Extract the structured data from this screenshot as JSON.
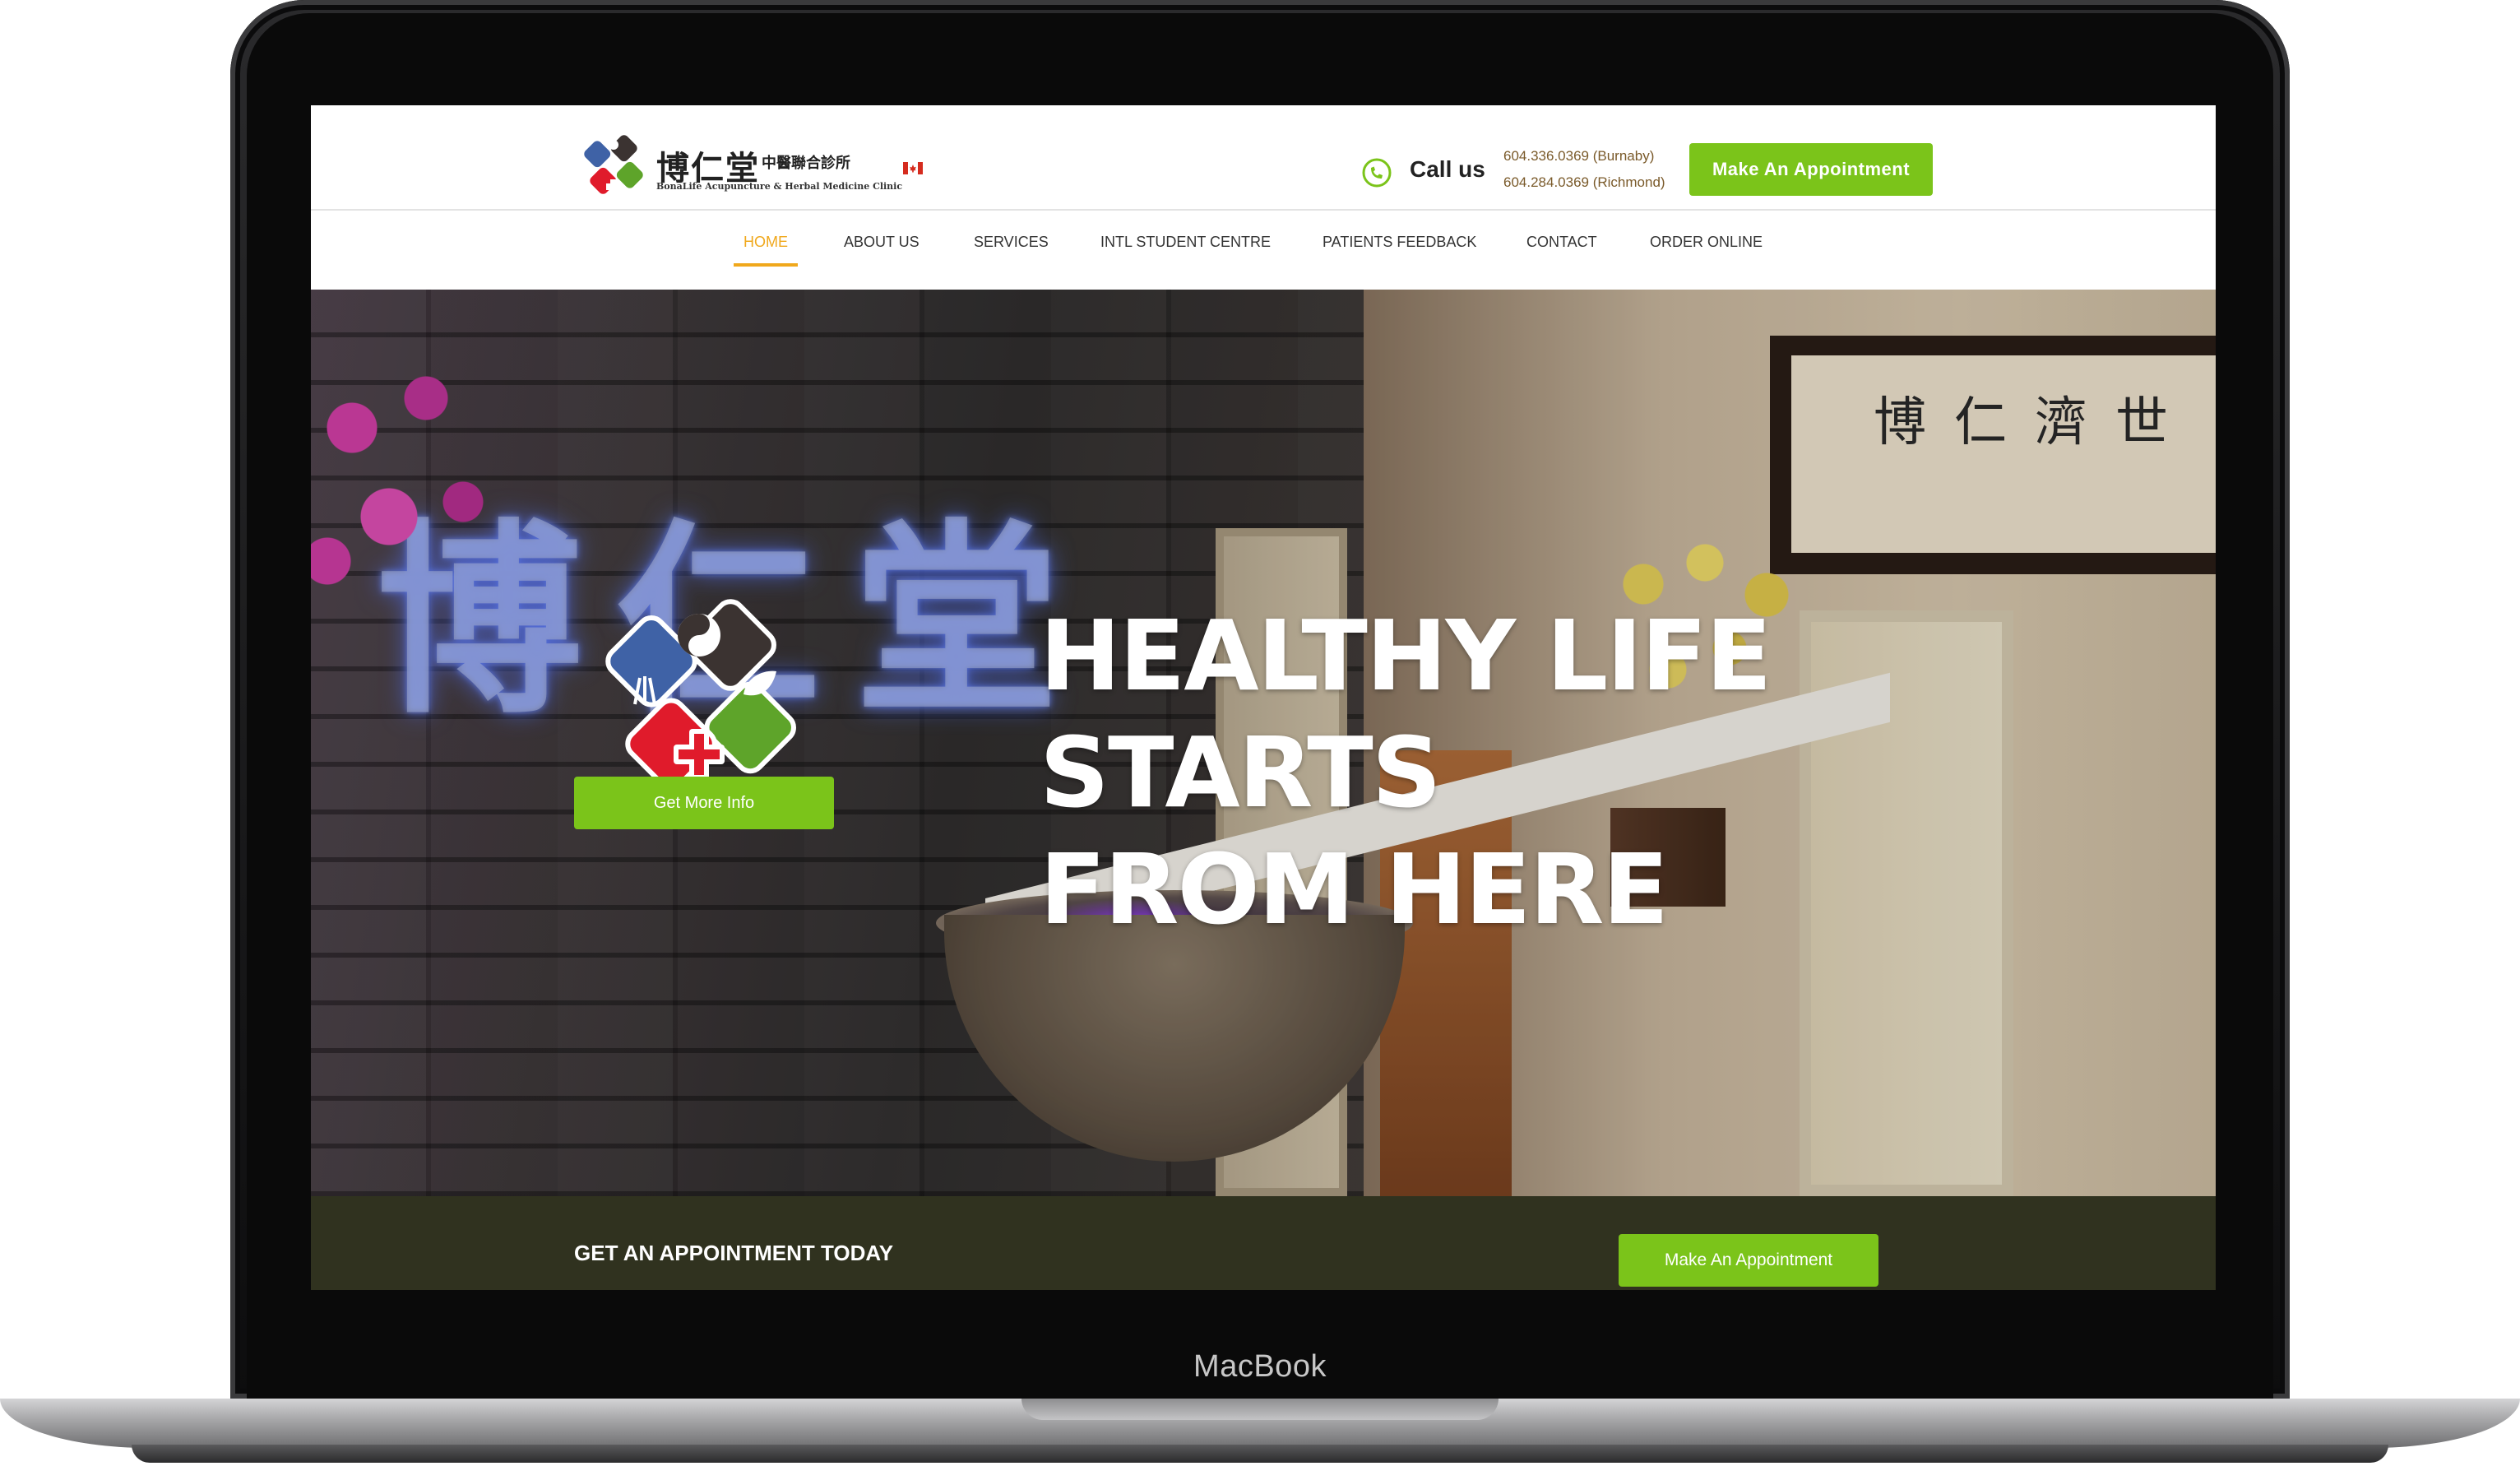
{
  "device": {
    "label": "MacBook"
  },
  "header": {
    "logo_chinese": "博仁堂",
    "logo_chinese_small": "中醫聯合診所",
    "logo_english": "BonaLife Acupuncture & Herbal Medicine Clinic",
    "call_label": "Call us",
    "phone_burnaby": "604.336.0369 (Burnaby)",
    "phone_richmond": "604.284.0369 (Richmond)",
    "appointment_button": "Make An Appointment"
  },
  "nav": {
    "items": [
      {
        "label": "HOME",
        "active": true
      },
      {
        "label": "ABOUT US"
      },
      {
        "label": "SERVICES"
      },
      {
        "label": "INTL STUDENT CENTRE"
      },
      {
        "label": "PATIENTS FEEDBACK"
      },
      {
        "label": "CONTACT"
      },
      {
        "label": "ORDER ONLINE"
      }
    ]
  },
  "hero": {
    "title_lines": [
      "HEALTHY LIFE",
      "STARTS",
      "FROM HERE"
    ],
    "cta_button": "Get More Info",
    "wall_sign": "博仁堂",
    "calligraphy": "博仁濟世"
  },
  "appointment_bar": {
    "text": "GET AN APPOINTMENT TODAY",
    "button": "Make An Appointment"
  },
  "colors": {
    "accent_green": "#7bc41a",
    "nav_active": "#f0a81c",
    "bar_background": "#30321f",
    "logo_blue": "#3f62a6",
    "logo_green": "#5ea42a",
    "logo_red": "#e01b2b",
    "logo_dark": "#3b3331"
  },
  "icons": {
    "logo": "bonalife-logo-icon",
    "flag": "canada-flag-icon",
    "phone": "phone-icon"
  }
}
